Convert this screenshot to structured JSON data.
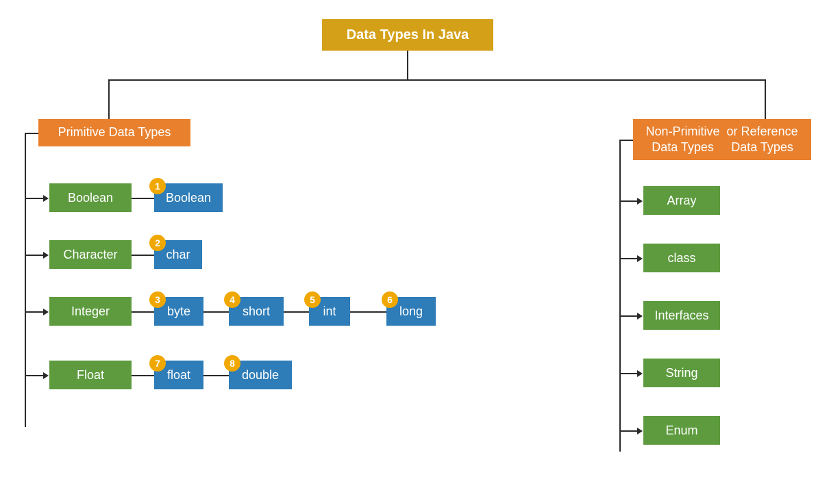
{
  "title": "Data Types In Java",
  "primitive": {
    "header": "Primitive Data Types",
    "categories": [
      {
        "name": "Boolean",
        "types": [
          {
            "label": "Boolean",
            "num": "1"
          }
        ]
      },
      {
        "name": "Character",
        "types": [
          {
            "label": "char",
            "num": "2"
          }
        ]
      },
      {
        "name": "Integer",
        "types": [
          {
            "label": "byte",
            "num": "3"
          },
          {
            "label": "short",
            "num": "4"
          },
          {
            "label": "int",
            "num": "5"
          },
          {
            "label": "long",
            "num": "6"
          }
        ]
      },
      {
        "name": "Float",
        "types": [
          {
            "label": "float",
            "num": "7"
          },
          {
            "label": "double",
            "num": "8"
          }
        ]
      }
    ]
  },
  "nonprimitive": {
    "header": "Non-Primitive Data Types\nor Reference Data Types",
    "header_line1": "Non-Primitive Data Types",
    "header_line2": "or Reference Data Types",
    "items": [
      "Array",
      "class",
      "Interfaces",
      "String",
      "Enum"
    ]
  }
}
